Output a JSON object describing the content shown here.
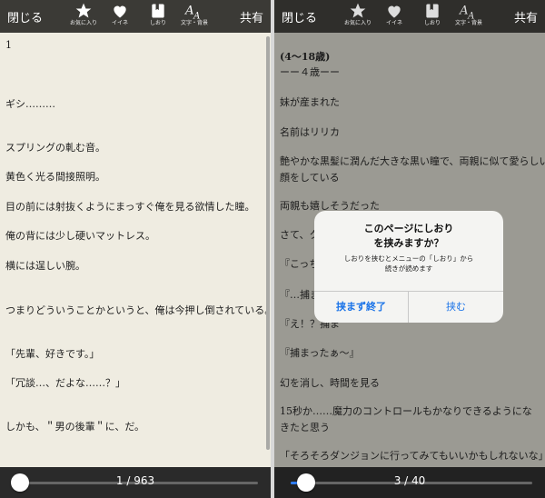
{
  "left": {
    "toolbar": {
      "close": "閉じる",
      "share": "共有",
      "items": [
        {
          "label": "お気に入り",
          "icon": "star-icon"
        },
        {
          "label": "イイネ",
          "icon": "heart-icon"
        },
        {
          "label": "しおり",
          "icon": "bookmark-icon"
        },
        {
          "label": "文字・背景",
          "icon": "font-settings-icon"
        }
      ]
    },
    "lines": [
      "1",
      "ギシ………",
      "スプリングの軋む音。",
      "黄色く光る間接照明。",
      "目の前には射抜くようにまっすぐ俺を見る欲情した瞳。",
      "俺の背には少し硬いマットレス。",
      "横には逞しい腕。",
      "つまりどういうことかというと、俺は今押し倒されている。",
      "「先輩、好きです。」",
      "「冗談…、だよな……？」",
      "しかも、＂男の後輩＂に、だ。"
    ],
    "page": "1 / 963",
    "progress": 0.0
  },
  "right": {
    "toolbar": {
      "close": "閉じる",
      "share": "共有",
      "items": [
        {
          "label": "お気に入り",
          "icon": "star-icon"
        },
        {
          "label": "イイネ",
          "icon": "heart-icon"
        },
        {
          "label": "しおり",
          "icon": "bookmark-icon"
        },
        {
          "label": "文字・背景",
          "icon": "font-settings-icon"
        }
      ]
    },
    "lines": [
      "(4〜18歳)",
      "ーー４歳ーー",
      "妹が産まれた",
      "名前はリリカ",
      "艶やかな黒髪に潤んだ大きな黒い瞳で、両親に似て愛らしい",
      "顔をしている",
      "両親も嬉しそうだった",
      "さて、ク",
      "『こっち",
      "『…捕ま",
      "『え！？捕ま",
      "『捕まったぁ〜』",
      "幻を消し、時間を見る",
      "15秒か……魔力のコントロールもかなりできるようにな",
      "きたと思う",
      "「そろそろダンジョンに行ってみてもいいかもしれないな」"
    ],
    "page": "3 / 40",
    "progress": 0.05,
    "dialog": {
      "title_line1": "このページにしおり",
      "title_line2": "を挟みますか？",
      "message_line1": "しおりを挟むとメニューの「しおり」から",
      "message_line2": "続きが読めます",
      "cancel": "挟まず終了",
      "confirm": "挟む"
    }
  },
  "colors": {
    "accent": "#1a73e8",
    "page_bg_left": "#efece1",
    "page_bg_right_dimmed": "#9b9a93"
  }
}
